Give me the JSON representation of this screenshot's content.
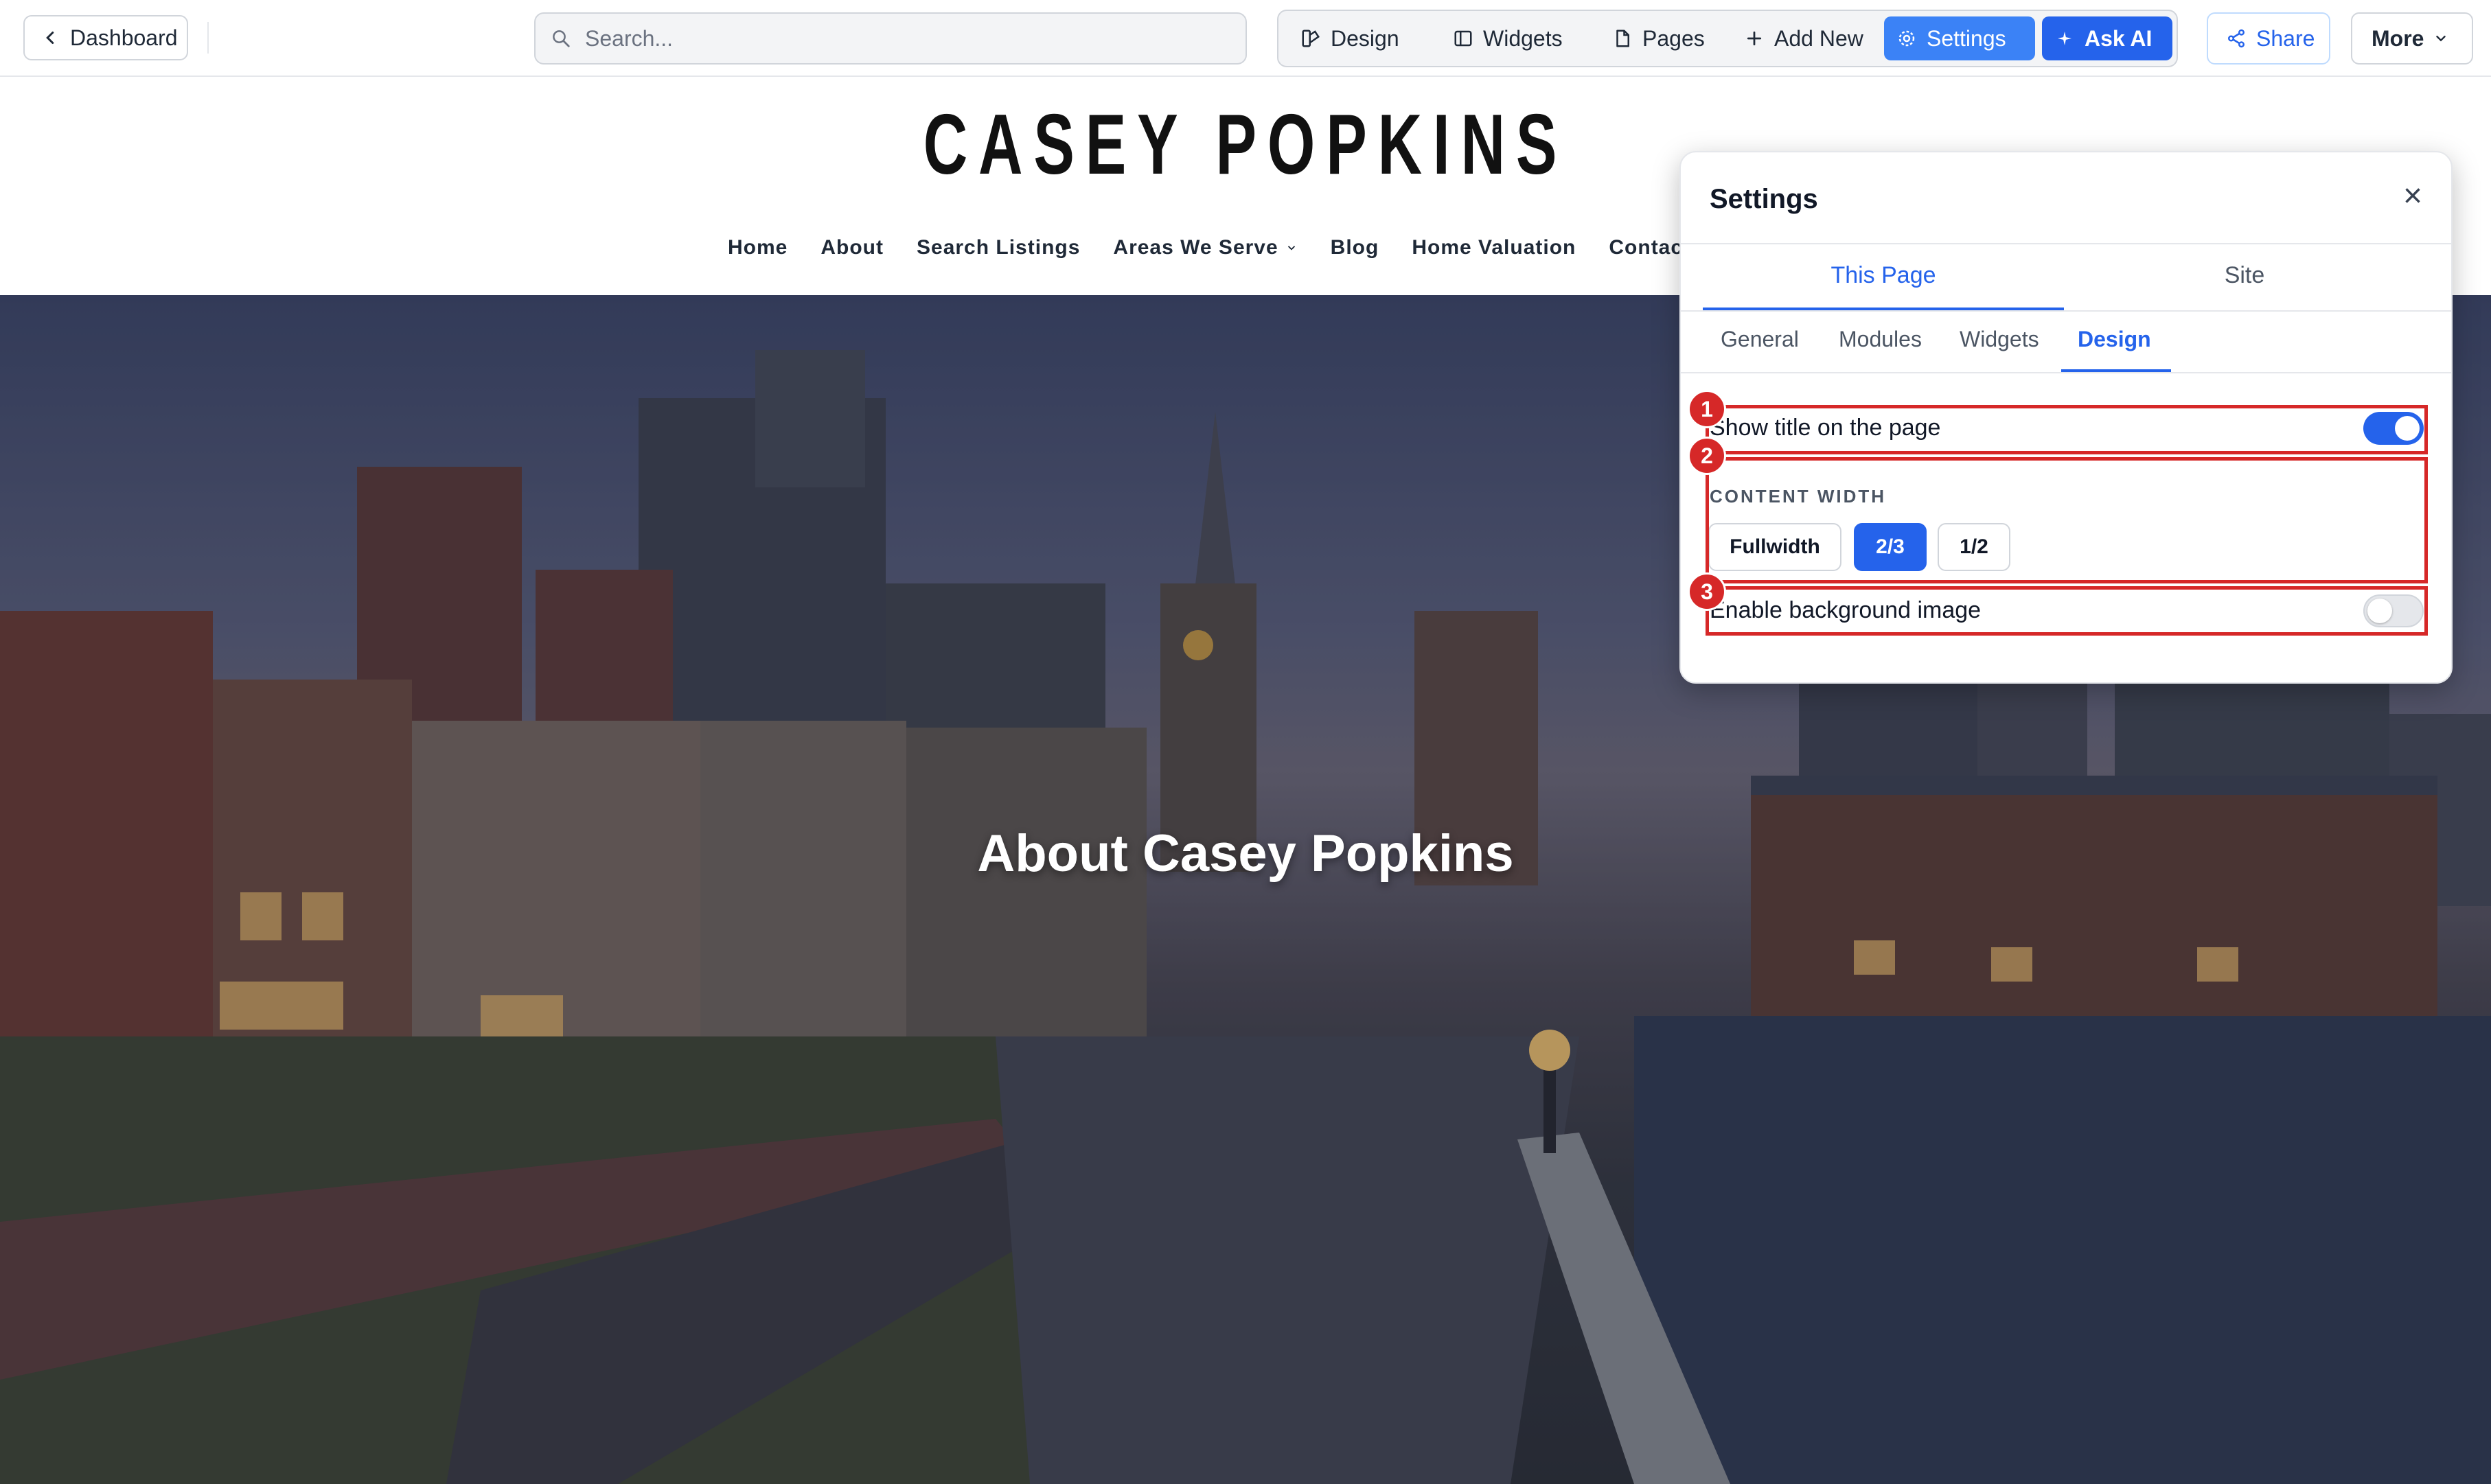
{
  "toolbar": {
    "dashboard_label": "Dashboard",
    "search_placeholder": "Search...",
    "design_label": "Design",
    "widgets_label": "Widgets",
    "pages_label": "Pages",
    "add_new_label": "Add New",
    "settings_label": "Settings",
    "ask_ai_label": "Ask AI",
    "share_label": "Share",
    "more_label": "More"
  },
  "site": {
    "logo": "CASEY POPKINS",
    "nav": [
      "Home",
      "About",
      "Search Listings",
      "Areas We Serve",
      "Blog",
      "Home Valuation",
      "Contact"
    ]
  },
  "hero": {
    "title": "About Casey Popkins"
  },
  "settings_panel": {
    "title": "Settings",
    "scope_tabs": [
      "This Page",
      "Site"
    ],
    "active_scope": "This Page",
    "sub_tabs": [
      "General",
      "Modules",
      "Widgets",
      "Design"
    ],
    "active_sub_tab": "Design",
    "show_title_label": "Show title on the page",
    "show_title_enabled": true,
    "content_width_label": "CONTENT WIDTH",
    "content_width_options": [
      "Fullwidth",
      "2/3",
      "1/2"
    ],
    "content_width_selected": "2/3",
    "bg_image_label": "Enable background image",
    "bg_image_enabled": false
  },
  "annotations": [
    "1",
    "2",
    "3"
  ],
  "colors": {
    "accent": "#2563eb",
    "annotation_red": "#d62828"
  }
}
